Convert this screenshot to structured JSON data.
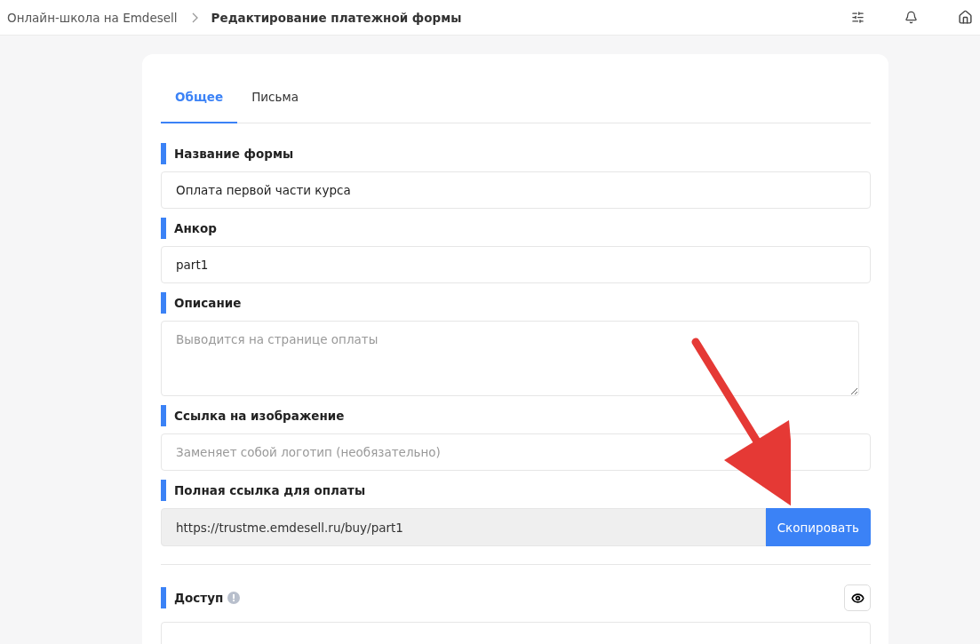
{
  "breadcrumb": {
    "parent": "Онлайн-школа на Emdesell",
    "current": "Редактирование платежной формы"
  },
  "tabs": [
    {
      "label": "Общее",
      "selected": true
    },
    {
      "label": "Письма",
      "selected": false
    }
  ],
  "fields": [
    {
      "kind": "input",
      "label": "Название формы",
      "value": "Оплата первой части курса"
    },
    {
      "kind": "input",
      "label": "Анкор",
      "value": "part1"
    },
    {
      "kind": "textarea",
      "label": "Описание",
      "placeholder": "Выводится на странице оплаты"
    },
    {
      "kind": "input",
      "label": "Ссылка на изображение",
      "placeholder": "Заменяет собой логотип (необязательно)"
    },
    {
      "kind": "copy",
      "label": "Полная ссылка для оплаты",
      "value": "https://trustme.emdesell.ru/buy/part1",
      "button": "Скопировать"
    }
  ],
  "access": {
    "label": "Доступ"
  }
}
